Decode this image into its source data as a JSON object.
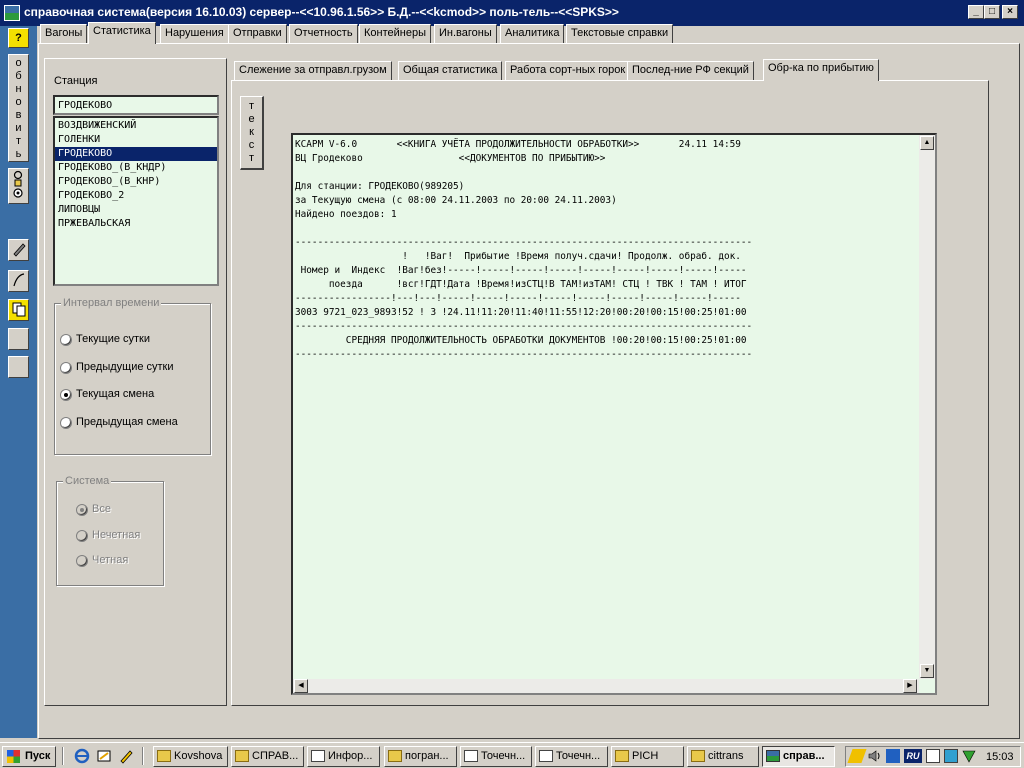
{
  "window": {
    "title": "справочная система(версия 16.10.03) сервер--<<10.96.1.56>> Б.Д.--<<kcmod>> поль-тель--<<SPKS>>",
    "minimize": "_",
    "maximize": "□",
    "close": "×"
  },
  "left_toolbar": {
    "help": "?",
    "refresh_letters": [
      "о",
      "б",
      "н",
      "о",
      "в",
      "и",
      "т",
      "ь"
    ]
  },
  "tabs": [
    "Вагоны",
    "Статистика",
    "Нарушения",
    "Отправки",
    "Отчетность",
    "Контейнеры",
    "Ин.вагоны",
    "Аналитика",
    "Текстовые справки"
  ],
  "station": {
    "label": "Станция",
    "value": "ГРОДЕКОВО",
    "items": [
      "ВОЗДВИЖЕНСКИЙ",
      "ГОЛЕНКИ",
      "ГРОДЕКОВО",
      "ГРОДЕКОВО_(В_КНДР)",
      "ГРОДЕКОВО_(В_КНР)",
      "ГРОДЕКОВО_2",
      "ЛИПОВЦЫ",
      "ПРЖЕВАЛЬСКАЯ"
    ],
    "selected": "ГРОДЕКОВО"
  },
  "interval": {
    "title": "Интервал времени",
    "options": [
      "Текущие сутки",
      "Предыдущие сутки",
      "Текущая смена",
      "Предыдущая смена"
    ],
    "selected": "Текущая смена"
  },
  "system": {
    "title": "Система",
    "options": [
      "Все",
      "Нечетная",
      "Четная"
    ],
    "selected": "Все"
  },
  "inner_tabs": [
    "Слежение за отправл.грузом",
    "Общая статистика",
    "Работа сорт-ных горок",
    "Послед-ние РФ секций",
    "Обр-ка по прибытию"
  ],
  "text_button": [
    "т",
    "е",
    "к",
    "с",
    "т"
  ],
  "report_lines": [
    "КСАРМ V-6.0       <<КНИГА УЧЁТА ПРОДОЛЖИТЕЛЬНОСТИ ОБРАБОТКИ>>       24.11 14:59",
    "ВЦ Гродеково                 <<ДОКУМЕНТОВ ПО ПРИБЫТИЮ>>",
    "",
    "Для станции: ГРОДЕКОВО(989205)",
    "за Текущую смена (с 08:00 24.11.2003 по 20:00 24.11.2003)",
    "Найдено поездов: 1",
    "",
    "---------------------------------------------------------------------------------",
    "                   !   !Ваг!  Прибытие !Время получ.сдачи! Продолж. обраб. док.",
    " Номер и  Индекс  !Ваг!без!-----!-----!-----!-----!-----!-----!-----!-----!-----",
    "      поезда      !всг!ГДТ!Дата !Время!изСТЦ!В ТАМ!изТАМ! СТЦ ! ТВК ! ТАМ ! ИТОГ",
    "-----------------!---!---!-----!-----!-----!-----!-----!-----!-----!-----!-----",
    "3003 9721_023_9893!52 ! 3 !24.11!11:20!11:40!11:55!12:20!00:20!00:15!00:25!01:00",
    "---------------------------------------------------------------------------------",
    "         СРЕДНЯЯ ПРОДОЛЖИТЕЛЬНОСТЬ ОБРАБОТКИ ДОКУМЕНТОВ !00:20!00:15!00:25!01:00",
    "---------------------------------------------------------------------------------"
  ],
  "taskbar": {
    "start": "Пуск",
    "buttons": [
      "Kovshova",
      "СПРАВ...",
      "Инфор...",
      "погран...",
      "Точечн...",
      "Точечн...",
      "PICH",
      "cittrans",
      "справ..."
    ],
    "active": "справ...",
    "clock": "15:03"
  },
  "colors": {
    "title_bar": "#0a246a",
    "toolbar_blue": "#3a6ea5",
    "panel_green": "#e8f8e8",
    "selection": "#0a246a"
  }
}
